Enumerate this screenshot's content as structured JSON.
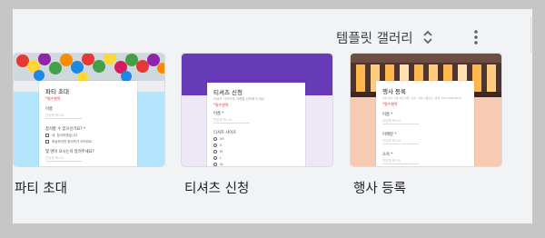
{
  "header": {
    "gallery_label": "템플릿 갤러리",
    "toggle_icon": "unfold-more-icon",
    "more_icon": "more-vert-icon"
  },
  "colors": {
    "panel_bg": "#f1f3f4",
    "party_accent": "#b3e5fc",
    "tshirt_accent": "#673ab7",
    "event_accent": "#f7cbb3"
  },
  "templates": [
    {
      "label": "파티 초대",
      "form": {
        "title": "파티 초대",
        "required_note": "*필수항목",
        "fields": [
          "이름",
          "참석할 수 있으신가요? *",
          "몇 명이 오시는지 알려주세요?"
        ],
        "placeholders": [
          "단답형 텍스트",
          "단답형 텍스트"
        ],
        "choices": [
          "네, 참석하겠습니다",
          "죄송하지만 참석하기 어려워요"
        ]
      }
    },
    {
      "label": "티셔츠 신청",
      "form": {
        "title": "티셔츠 신청",
        "required_note": "*필수항목",
        "description": "티셔츠 사이즈와 이름을 입력해 주세요",
        "fields": [
          "이름 *",
          "티셔츠 사이즈"
        ],
        "placeholder": "단답형 텍스트",
        "sizes": [
          "XS",
          "S",
          "M",
          "L",
          "XL"
        ]
      }
    },
    {
      "label": "행사 등록",
      "form": {
        "title": "행사 등록",
        "required_note": "*필수항목",
        "description": "행사 일시: 1월 4일~6일 / 장소: 서울시 종로구 / 문의: 010-1234-5678",
        "fields": [
          "이름 *",
          "이메일 *",
          "소속 *"
        ],
        "placeholder": "단답형 텍스트"
      }
    }
  ]
}
